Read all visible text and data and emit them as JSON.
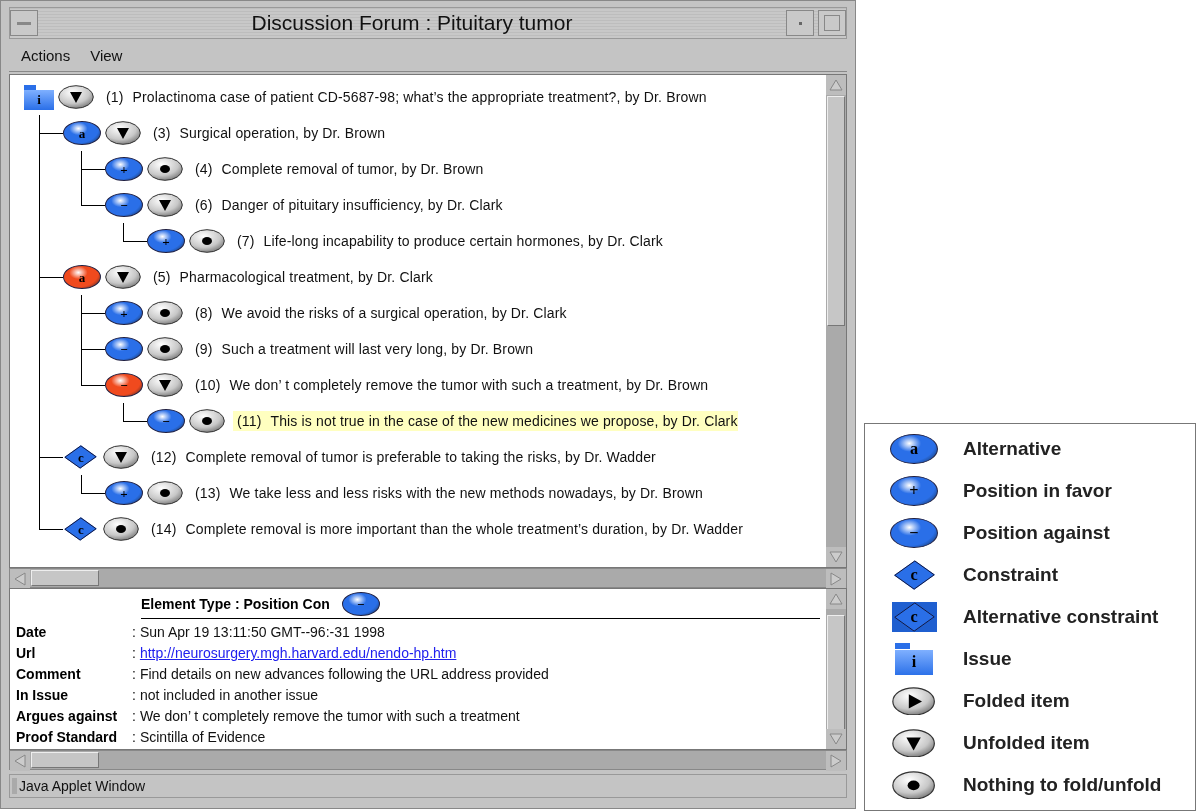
{
  "window": {
    "title": "Discussion Forum : Pituitary tumor"
  },
  "menu": [
    {
      "label": "Actions"
    },
    {
      "label": "View"
    }
  ],
  "tree": [
    {
      "kind": "folder",
      "color": "#2a6fe8",
      "symbol": "i",
      "foldable": true,
      "expanded": true,
      "number": "(1)",
      "text": "Prolactinoma case of patient CD-5687-98; what’s the appropriate treatment?, by Dr. Brown",
      "selected": false,
      "children": [
        {
          "kind": "oval",
          "color": "#2a6fe8",
          "symbol": "a",
          "foldable": true,
          "expanded": true,
          "number": "(3)",
          "text": "Surgical operation, by Dr. Brown",
          "selected": false,
          "children": [
            {
              "kind": "oval",
              "color": "#2a6fe8",
              "symbol": "+",
              "foldable": false,
              "number": "(4)",
              "text": "Complete removal of tumor, by Dr. Brown",
              "selected": false
            },
            {
              "kind": "oval",
              "color": "#2a6fe8",
              "symbol": "−",
              "foldable": true,
              "expanded": true,
              "number": "(6)",
              "text": "Danger of pituitary insufficiency, by Dr. Clark",
              "selected": false,
              "children": [
                {
                  "kind": "oval",
                  "color": "#2a6fe8",
                  "symbol": "+",
                  "foldable": false,
                  "number": "(7)",
                  "text": "Life-long incapability to produce certain hormones, by Dr. Clark",
                  "selected": false
                }
              ]
            }
          ]
        },
        {
          "kind": "oval",
          "color": "#f04a1e",
          "symbol": "a",
          "foldable": true,
          "expanded": true,
          "number": "(5)",
          "text": "Pharmacological treatment, by Dr. Clark",
          "selected": false,
          "children": [
            {
              "kind": "oval",
              "color": "#2a6fe8",
              "symbol": "+",
              "foldable": false,
              "number": "(8)",
              "text": "We avoid the risks of a surgical operation, by Dr. Clark",
              "selected": false
            },
            {
              "kind": "oval",
              "color": "#2a6fe8",
              "symbol": "−",
              "foldable": false,
              "number": "(9)",
              "text": "Such a treatment will last very long, by Dr. Brown",
              "selected": false
            },
            {
              "kind": "oval",
              "color": "#f04a1e",
              "symbol": "−",
              "foldable": true,
              "expanded": true,
              "number": "(10)",
              "text": "We don’ t completely remove the tumor with such a treatment, by Dr. Brown",
              "selected": false,
              "children": [
                {
                  "kind": "oval",
                  "color": "#2a6fe8",
                  "symbol": "−",
                  "foldable": false,
                  "number": "(11)",
                  "text": "This is not true in the case of the new medicines we propose, by Dr. Clark",
                  "selected": true
                }
              ]
            }
          ]
        },
        {
          "kind": "diamond",
          "color": "#2a6fe8",
          "symbol": "c",
          "foldable": true,
          "expanded": true,
          "number": "(12)",
          "text": "Complete removal of tumor is preferable to taking the risks, by Dr. Wadder",
          "selected": false,
          "children": [
            {
              "kind": "oval",
              "color": "#2a6fe8",
              "symbol": "+",
              "foldable": false,
              "number": "(13)",
              "text": "We take less and less risks with the new methods nowadays, by Dr. Brown",
              "selected": false
            }
          ]
        },
        {
          "kind": "diamond",
          "color": "#2a6fe8",
          "symbol": "c",
          "foldable": false,
          "number": "(14)",
          "text": "Complete removal is more important than the whole treatment’s duration, by Dr. Wadder",
          "selected": false
        }
      ]
    }
  ],
  "details": {
    "heading": "Element Type : Position Con",
    "icon": {
      "kind": "oval",
      "color": "#2a6fe8",
      "symbol": "−"
    },
    "fields": [
      {
        "label": "Date",
        "separator": ":",
        "value": "Sun Apr 19 13:11:50 GMT--96:-31 1998",
        "kind": "text"
      },
      {
        "label": "Url",
        "separator": ":",
        "value": "http://neurosurgery.mgh.harvard.edu/nendo-hp.htm",
        "kind": "link"
      },
      {
        "label": "Comment",
        "separator": ":",
        "value": "Find details on new advances following the URL address provided",
        "kind": "text"
      },
      {
        "label": "In Issue",
        "separator": ":",
        "value": "not included in another issue",
        "kind": "text"
      },
      {
        "label": "Argues against",
        "separator": ":",
        "value": "We don’ t completely remove the tumor with such a treatment",
        "kind": "text"
      },
      {
        "label": "Proof Standard",
        "separator": ":",
        "value": "Scintilla of Evidence",
        "kind": "text"
      }
    ]
  },
  "status_bar": {
    "text": "Java Applet Window"
  },
  "legend": [
    {
      "kind": "oval",
      "symbol": "a",
      "label": "Alternative"
    },
    {
      "kind": "oval",
      "symbol": "+",
      "label": "Position in favor"
    },
    {
      "kind": "oval",
      "symbol": "−",
      "label": "Position against"
    },
    {
      "kind": "diamond",
      "symbol": "c",
      "label": "Constraint"
    },
    {
      "kind": "framed_diamond",
      "symbol": "c",
      "label": "Alternative constraint"
    },
    {
      "kind": "folder",
      "symbol": "i",
      "label": "Issue"
    },
    {
      "kind": "folded",
      "label": "Folded item"
    },
    {
      "kind": "unfolded",
      "label": "Unfolded item"
    },
    {
      "kind": "leaf",
      "label": "Nothing to fold/unfold"
    }
  ]
}
